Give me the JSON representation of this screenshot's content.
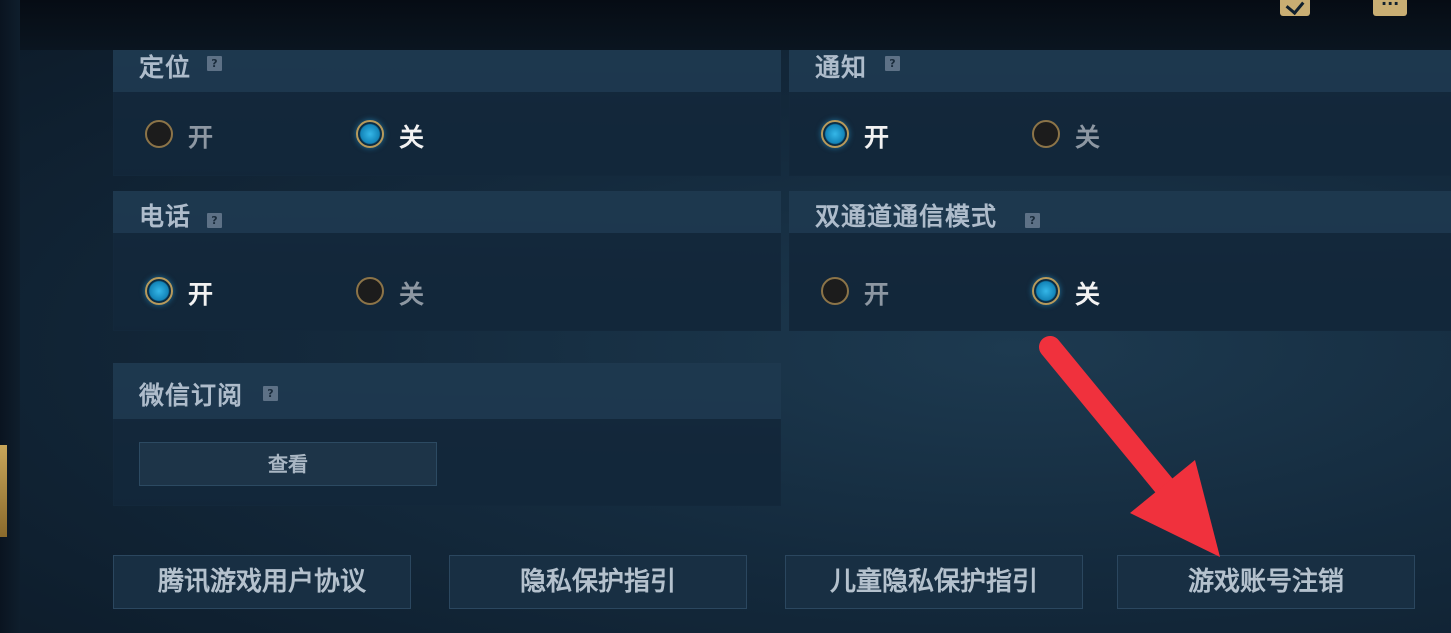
{
  "settings": {
    "location": {
      "title": "定位",
      "on_label": "开",
      "off_label": "关",
      "selected": "off"
    },
    "notification": {
      "title": "通知",
      "on_label": "开",
      "off_label": "关",
      "selected": "on"
    },
    "phone": {
      "title": "电话",
      "on_label": "开",
      "off_label": "关",
      "selected": "on"
    },
    "dual_channel": {
      "title": "双通道通信模式",
      "on_label": "开",
      "off_label": "关",
      "selected": "off"
    },
    "wechat": {
      "title": "微信订阅",
      "view_label": "查看"
    }
  },
  "help_glyph": "?",
  "footer": {
    "user_agreement": "腾讯游戏用户协议",
    "privacy_guide": "隐私保护指引",
    "child_privacy_guide": "儿童隐私保护指引",
    "account_cancel": "游戏账号注销"
  },
  "icons": [
    "checklist-icon",
    "chat-icon",
    "help-icon",
    "red-arrow-annotation"
  ],
  "colors": {
    "accent": "#1e9fd8",
    "gold": "#b79a5c",
    "annotation": "#f0313d"
  }
}
